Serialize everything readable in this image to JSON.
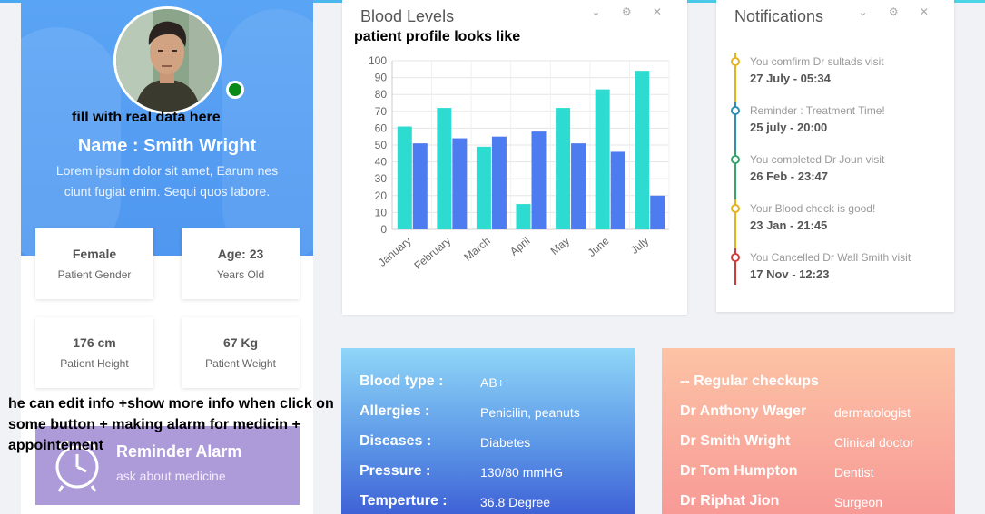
{
  "annotations": {
    "fill": "fill with real data here",
    "profile": "patient profile looks like",
    "edit_line1": "he can edit info +show more info when click on",
    "edit_line2": "some button + making alarm for medicin +",
    "edit_line3": "appointement"
  },
  "profile": {
    "name": "Name : Smith Wright",
    "bio_line1": "Lorem ipsum dolor sit amet, Earum nes",
    "bio_line2": "ciunt fugiat enim. Sequi quos labore.",
    "stats": [
      {
        "value": "Female",
        "label": "Patient Gender"
      },
      {
        "value": "Age: 23",
        "label": "Years Old"
      },
      {
        "value": "176 cm",
        "label": "Patient Height"
      },
      {
        "value": "67 Kg",
        "label": "Patient Weight"
      }
    ],
    "reminder": {
      "title": "Reminder Alarm",
      "subtitle": "ask about medicine"
    }
  },
  "blood_card": {
    "title": "Blood Levels",
    "tools": "⌄ ⚙ ✕"
  },
  "chart_data": {
    "type": "bar",
    "title": "",
    "categories": [
      "January",
      "February",
      "March",
      "April",
      "May",
      "June",
      "July"
    ],
    "series": [
      {
        "color": "#2ddbd0",
        "values": [
          61,
          72,
          49,
          15,
          72,
          83,
          94
        ]
      },
      {
        "color": "#4d7cf0",
        "values": [
          51,
          54,
          55,
          58,
          51,
          46,
          20
        ]
      }
    ],
    "ylim": [
      0,
      100
    ],
    "yticks": [
      0,
      10,
      20,
      30,
      40,
      50,
      60,
      70,
      80,
      90,
      100
    ],
    "grid": true
  },
  "notifications": {
    "title": "Notifications",
    "tools": "⌄ ⚙ ✕",
    "items": [
      {
        "text": "You comfirm Dr sultads visit",
        "time": "27 July - 05:34",
        "color": "#e5b21f"
      },
      {
        "text": "Reminder : Treatment Time!",
        "time": "25 july - 20:00",
        "color": "#2d8fb5"
      },
      {
        "text": "You completed Dr Joun visit",
        "time": "26 Feb - 23:47",
        "color": "#33a56a"
      },
      {
        "text": "Your Blood check is good!",
        "time": "23 Jan - 21:45",
        "color": "#e5b21f"
      },
      {
        "text": "You Cancelled Dr Wall Smith visit",
        "time": "17 Nov - 12:23",
        "color": "#c9403b"
      }
    ]
  },
  "medical": {
    "rows": [
      {
        "label": "Blood type :",
        "value": "AB+"
      },
      {
        "label": "Allergies :",
        "value": "Penicilin, peanuts"
      },
      {
        "label": "Diseases :",
        "value": "Diabetes"
      },
      {
        "label": "Pressure :",
        "value": "130/80 mmHG"
      },
      {
        "label": "Temperture :",
        "value": "36.8 Degree"
      }
    ]
  },
  "checkups": {
    "heading": "-- Regular checkups",
    "rows": [
      {
        "doctor": "Dr Anthony Wager",
        "specialty": "dermatologist"
      },
      {
        "doctor": "Dr Smith Wright",
        "specialty": "Clinical doctor"
      },
      {
        "doctor": "Dr Tom Humpton",
        "specialty": "Dentist"
      },
      {
        "doctor": "Dr Riphat Jion",
        "specialty": "Surgeon"
      }
    ]
  }
}
